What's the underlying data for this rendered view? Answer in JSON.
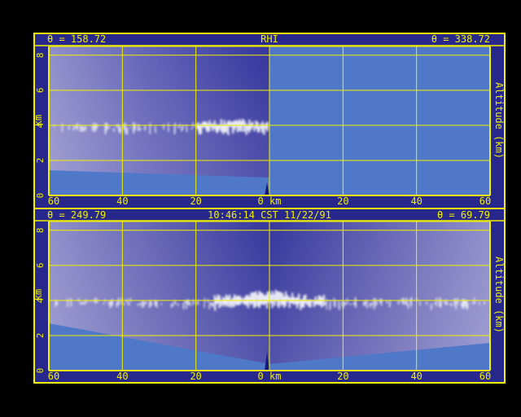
{
  "colors": {
    "frame": "#f0f000",
    "panel_bg": "#28288c",
    "plot_blue": "#4f78c8",
    "echo": "#ffffff",
    "background": "#000000"
  },
  "chart_data": [
    {
      "type": "heatmap",
      "title": "RHI",
      "left_label": "θ = 158.72",
      "right_label": "θ = 338.72",
      "xlabel": "0 km",
      "ylabel": "km",
      "right_ylabel": "Altitude (km)",
      "x_ticks": [
        "60",
        "40",
        "20",
        "0 km",
        "20",
        "40",
        "60"
      ],
      "y_ticks": [
        "0",
        "2",
        "4",
        "6",
        "8"
      ],
      "xlim": [
        -60,
        60
      ],
      "ylim": [
        0,
        8.5
      ],
      "grid": true,
      "echo_layer": {
        "left_range_km": [
          -60,
          0
        ],
        "base_km": 3.0,
        "top_km": 4.0,
        "peak_top_km": 4.3,
        "peak_range_km": [
          -20,
          0
        ]
      }
    },
    {
      "type": "heatmap",
      "title": "10:46:14 CST 11/22/91",
      "left_label": "θ = 249.79",
      "right_label": "θ = 69.79",
      "xlabel": "0 km",
      "ylabel": "km",
      "right_ylabel": "Altitude (km)",
      "x_ticks": [
        "60",
        "40",
        "20",
        "0 km",
        "20",
        "40",
        "60"
      ],
      "y_ticks": [
        "0",
        "2",
        "4",
        "6",
        "8"
      ],
      "xlim": [
        -60,
        60
      ],
      "ylim": [
        0,
        8.5
      ],
      "grid": true,
      "echo_layer": {
        "range_km": [
          -60,
          60
        ],
        "base_km": 3.0,
        "top_km": 4.0,
        "peak_top_km": 4.5,
        "peak_range_km": [
          -15,
          15
        ]
      }
    }
  ]
}
